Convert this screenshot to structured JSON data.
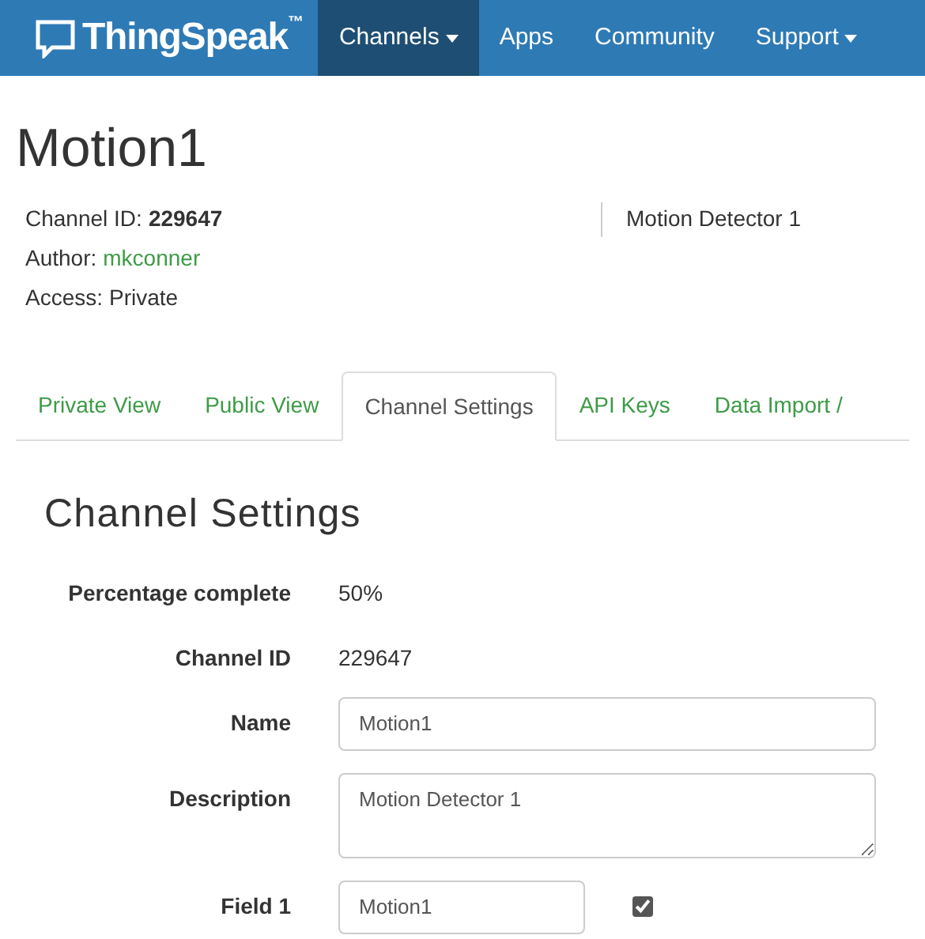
{
  "brand": {
    "name": "ThingSpeak",
    "mark": "™"
  },
  "nav": [
    {
      "label": "Channels",
      "dropdown": true,
      "selected": true
    },
    {
      "label": "Apps",
      "dropdown": false,
      "selected": false
    },
    {
      "label": "Community",
      "dropdown": false,
      "selected": false
    },
    {
      "label": "Support",
      "dropdown": true,
      "selected": false
    }
  ],
  "title": "Motion1",
  "meta": [
    {
      "label": "Channel ID:",
      "value": "229647",
      "kind": "bold"
    },
    {
      "label": "Author:",
      "value": "mkconner",
      "kind": "link"
    },
    {
      "label": "Access:",
      "value": "Private",
      "kind": "plain"
    }
  ],
  "description": "Motion Detector 1",
  "tabs": [
    {
      "label": "Private View",
      "selected": false
    },
    {
      "label": "Public View",
      "selected": false
    },
    {
      "label": "Channel Settings",
      "selected": true
    },
    {
      "label": "API Keys",
      "selected": false
    },
    {
      "label": "Data Import /",
      "selected": false
    }
  ],
  "section_title": "Channel Settings",
  "rows": [
    {
      "label": "Percentage complete",
      "kind": "text",
      "value": "50%"
    },
    {
      "label": "Channel ID",
      "kind": "text",
      "value": "229647"
    },
    {
      "label": "Name",
      "kind": "input",
      "value": "Motion1"
    },
    {
      "label": "Description",
      "kind": "textarea",
      "value": "Motion Detector 1"
    },
    {
      "label": "Field 1",
      "kind": "field",
      "value": "Motion1",
      "checked": true
    }
  ]
}
